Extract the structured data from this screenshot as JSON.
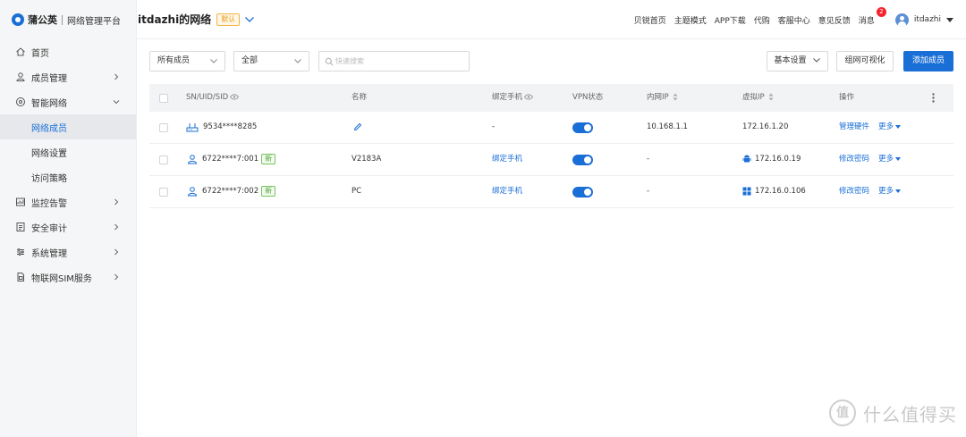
{
  "brand": {
    "name": "蒲公英",
    "subtitle": "网络管理平台"
  },
  "sidebar": {
    "items": [
      {
        "label": "首页",
        "icon": "home-icon"
      },
      {
        "label": "成员管理",
        "icon": "user-icon"
      },
      {
        "label": "智能网络",
        "icon": "network-icon"
      },
      {
        "label": "网络成员",
        "sub": true,
        "active": true
      },
      {
        "label": "网络设置",
        "sub": true
      },
      {
        "label": "访问策略",
        "sub": true
      },
      {
        "label": "监控告警",
        "icon": "monitor-icon"
      },
      {
        "label": "安全审计",
        "icon": "audit-icon"
      },
      {
        "label": "系统管理",
        "icon": "settings-icon"
      },
      {
        "label": "物联网SIM服务",
        "icon": "sim-icon"
      }
    ]
  },
  "header": {
    "network_name": "itdazhi的网络",
    "default_badge": "默认",
    "links": [
      "贝锐首页",
      "主题模式",
      "APP下载",
      "代购",
      "客服中心",
      "意见反馈"
    ],
    "messages_label": "消息",
    "messages_count": "2",
    "username": "itdazhi"
  },
  "toolbar": {
    "member_filter": "所有成员",
    "type_filter": "全部",
    "search_placeholder": "快速搜索",
    "basic_settings": "基本设置",
    "visualize": "组网可视化",
    "add_member": "添加成员"
  },
  "table": {
    "columns": {
      "sn": "SN/UID/SID",
      "name": "名称",
      "phone": "绑定手机",
      "vpn": "VPN状态",
      "lan_ip": "内网IP",
      "virtual_ip": "虚拟IP",
      "ops": "操作"
    },
    "rows": [
      {
        "id": "9534****8285",
        "new": "",
        "name": "",
        "phone": "-",
        "vpn": "on",
        "lan_ip": "10.168.1.1",
        "virtual_ip": "172.16.1.20",
        "op": "管理硬件",
        "more": "更多"
      },
      {
        "id": "6722****7:001",
        "new": "新",
        "name": "V2183A",
        "phone": "绑定手机",
        "vpn": "on",
        "lan_ip": "-",
        "virtual_ip": "172.16.0.19",
        "op": "修改密码",
        "more": "更多"
      },
      {
        "id": "6722****7:002",
        "new": "新",
        "name": "PC",
        "phone": "绑定手机",
        "vpn": "on",
        "lan_ip": "-",
        "virtual_ip": "172.16.0.106",
        "op": "修改密码",
        "more": "更多"
      }
    ]
  },
  "watermark": {
    "symbol": "值",
    "text": "什么值得买"
  },
  "colors": {
    "accent": "#1a6fd6",
    "badge": "#f5222d",
    "new_tag": "#52a63a",
    "default_badge": "#e89b1b"
  }
}
